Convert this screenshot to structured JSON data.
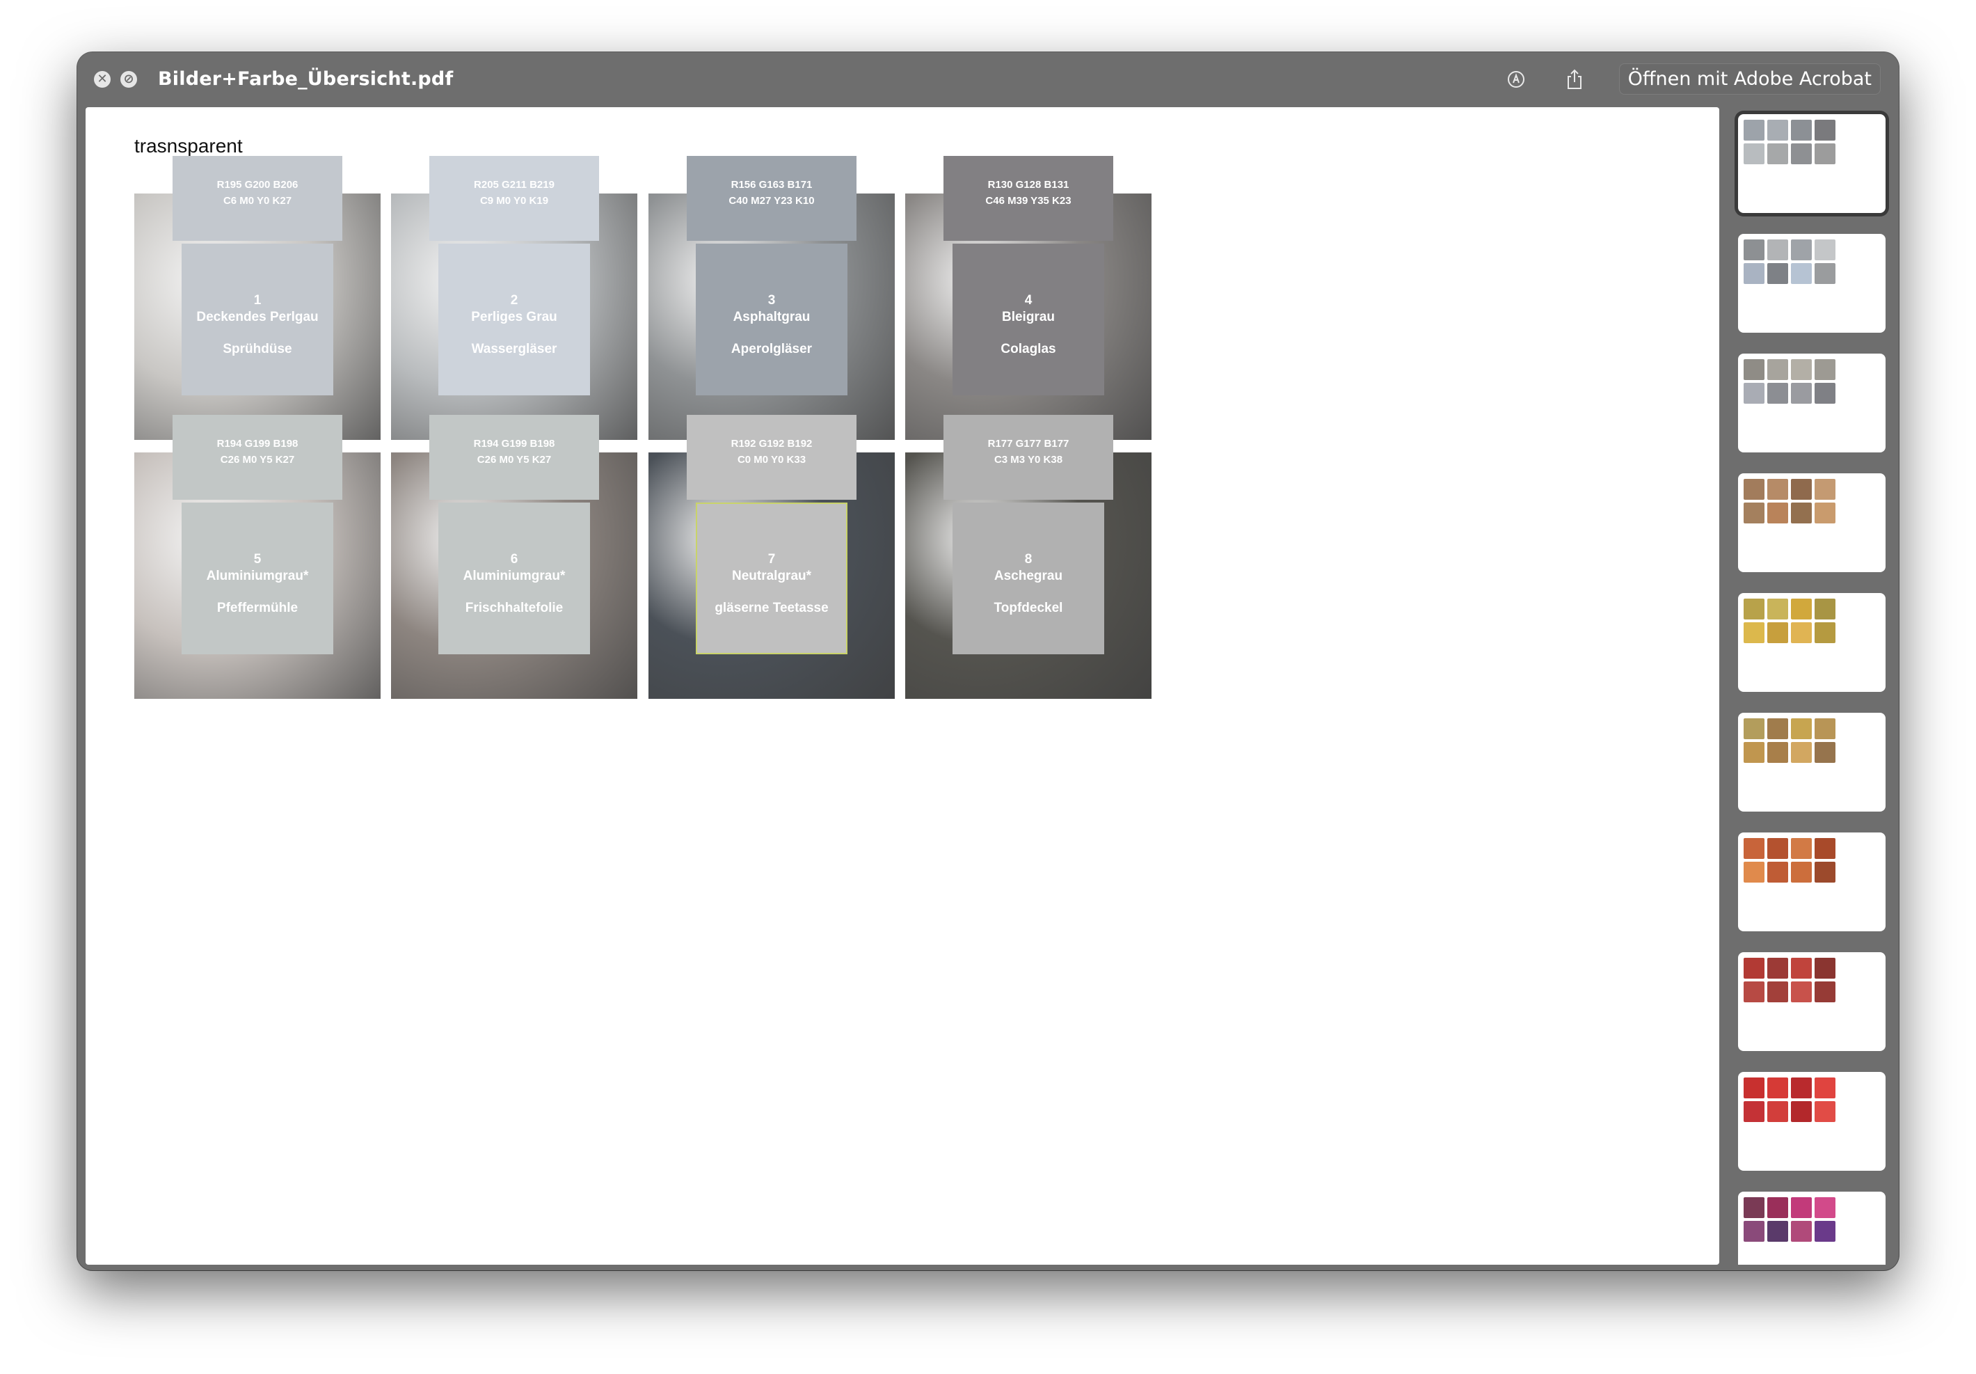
{
  "window": {
    "title": "Bilder+Farbe_Übersicht.pdf",
    "close_glyph": "✕",
    "stop_glyph": "⊘",
    "open_button": "Öffnen mit Adobe Acrobat",
    "icons": [
      "close-icon",
      "stop-icon",
      "markup-icon",
      "share-icon"
    ]
  },
  "page": {
    "label": "trasnsparent",
    "swatches": [
      {
        "num": "1",
        "name": "Deckendes Perlgau",
        "object": "Sprühdüse",
        "rgb": "R195 G200 B206",
        "cmyk": "C6 M0 Y0 K27",
        "color": "#c3c8ce",
        "photo": "#c9c7c4"
      },
      {
        "num": "2",
        "name": "Perliges Grau",
        "object": "Wassergläser",
        "rgb": "R205 G211 B219",
        "cmyk": "C9 M0 Y0 K19",
        "color": "#cdd3db",
        "photo": "#b9bcbe"
      },
      {
        "num": "3",
        "name": "Asphaltgrau",
        "object": "Aperolgläser",
        "rgb": "R156 G163 B171",
        "cmyk": "C40 M27 Y23 K10",
        "color": "#9ca3ab",
        "photo": "#8f9294"
      },
      {
        "num": "4",
        "name": "Bleigrau",
        "object": "Colaglas",
        "rgb": "R130 G128 B131",
        "cmyk": "C46 M39 Y35 K23",
        "color": "#828083",
        "photo": "#8a8785"
      },
      {
        "num": "5",
        "name": "Aluminiumgrau*",
        "object": "Pfeffermühle",
        "rgb": "R194 G199 B198",
        "cmyk": "C26 M0 Y5 K27",
        "color": "#c2c7c6",
        "photo": "#c7c1bd"
      },
      {
        "num": "6",
        "name": "Aluminiumgrau*",
        "object": "Frischhaltefolie",
        "rgb": "R194 G199 B198",
        "cmyk": "C26 M0 Y5 K27",
        "color": "#c2c7c6",
        "photo": "#8d8580"
      },
      {
        "num": "7",
        "name": "Neutralgrau*",
        "object": "gläserne Teetasse",
        "rgb": "R192 G192 B192",
        "cmyk": "C0 M0 Y0 K33",
        "color": "#c0c0c0",
        "photo": "#4b5158"
      },
      {
        "num": "8",
        "name": "Aschegrau",
        "object": "Topfdeckel",
        "rgb": "R177 G177 B177",
        "cmyk": "C3 M3 Y0 K38",
        "color": "#b1b1b1",
        "photo": "#55544f"
      }
    ]
  },
  "sidebar": {
    "thumbnails": [
      {
        "selected": true,
        "colors": [
          "#9da3aa",
          "#a8adb3",
          "#8c9095",
          "#7a7a7d",
          "#b8bcbf",
          "#a6a8a9",
          "#8e9093",
          "#9c9c9c"
        ]
      },
      {
        "selected": false,
        "colors": [
          "#8d9093",
          "#b2b4b6",
          "#9fa3a8",
          "#c4c6c8",
          "#a9b3c2",
          "#7e8186",
          "#b6c3d3",
          "#9a9c9e"
        ]
      },
      {
        "selected": false,
        "colors": [
          "#8f8c86",
          "#a7a49d",
          "#b3afa6",
          "#9d9a93",
          "#a9acb4",
          "#8c8e93",
          "#9a9ba0",
          "#7f8085"
        ]
      },
      {
        "selected": false,
        "colors": [
          "#a27c5c",
          "#b68b67",
          "#8f6a4d",
          "#c49a72",
          "#a4805e",
          "#b9835a",
          "#93704f",
          "#c99b6d"
        ]
      },
      {
        "selected": false,
        "colors": [
          "#b8a24a",
          "#c9b45a",
          "#d1a83c",
          "#a89544",
          "#dcb84c",
          "#c79f3d",
          "#e0b453",
          "#b59a40"
        ]
      },
      {
        "selected": false,
        "colors": [
          "#b39d5c",
          "#a07c4c",
          "#c7a550",
          "#b89556",
          "#c0964f",
          "#a87f4a",
          "#d2a761",
          "#96744d"
        ]
      },
      {
        "selected": false,
        "colors": [
          "#c8643a",
          "#b4522f",
          "#d27a45",
          "#a84a2a",
          "#e08a4c",
          "#bf5c35",
          "#cc6e3c",
          "#9c4a2c"
        ]
      },
      {
        "selected": false,
        "colors": [
          "#b23a34",
          "#9c3a36",
          "#c0443c",
          "#8a3530",
          "#b74a44",
          "#a2403a",
          "#c8524b",
          "#963b36"
        ]
      },
      {
        "selected": false,
        "colors": [
          "#c8302f",
          "#d63a36",
          "#b92a2d",
          "#e0443f",
          "#c43236",
          "#d23e3b",
          "#b3282b",
          "#e14c46"
        ]
      },
      {
        "selected": false,
        "colors": [
          "#7a3a55",
          "#9a2f5a",
          "#c23a7a",
          "#d24a8a",
          "#8a4a7a",
          "#5a3a6a",
          "#b04a7a",
          "#6a3a8a"
        ]
      }
    ]
  }
}
